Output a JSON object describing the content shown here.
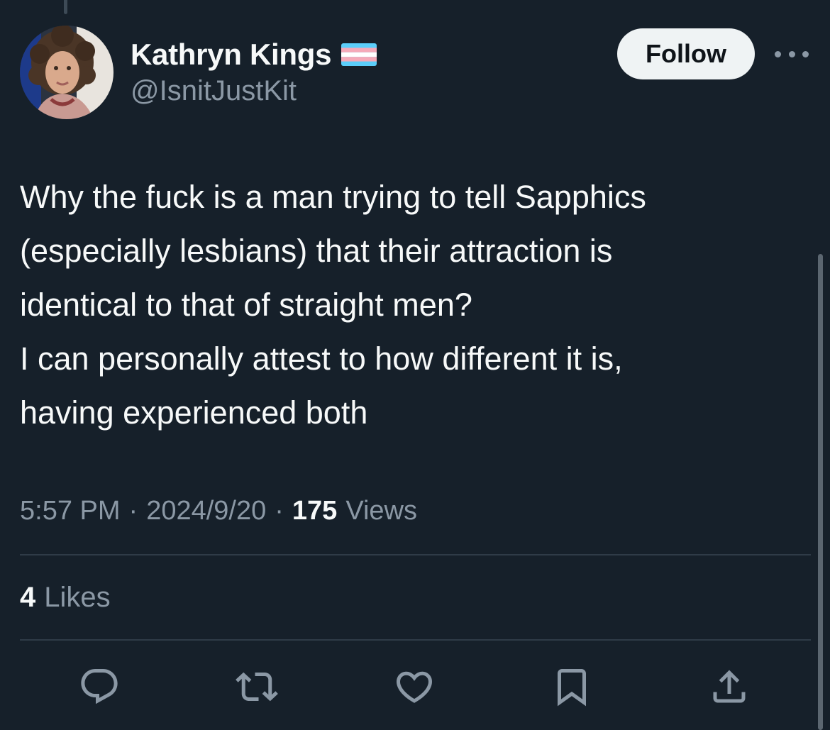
{
  "author": {
    "display_name": "Kathryn Kings",
    "handle": "@IsnitJustKit",
    "name_badge_icon": "transgender-flag-icon"
  },
  "header": {
    "follow_label": "Follow",
    "more_icon": "more-horizontal-icon"
  },
  "tweet": {
    "lines": [
      "Why the fuck is a man trying to tell Sapphics",
      "(especially lesbians) that their attraction is",
      "identical to that of straight men?",
      "I can personally attest to how different it is,",
      "having experienced both"
    ]
  },
  "meta": {
    "time": "5:57 PM",
    "separator": "·",
    "date": "2024/9/20",
    "views_count": "175",
    "views_label": "Views"
  },
  "engagement": {
    "likes_count": "4",
    "likes_label": "Likes"
  },
  "actions": [
    {
      "name": "reply",
      "icon": "reply-icon"
    },
    {
      "name": "retweet",
      "icon": "retweet-icon"
    },
    {
      "name": "like",
      "icon": "heart-icon"
    },
    {
      "name": "bookmark",
      "icon": "bookmark-icon"
    },
    {
      "name": "share",
      "icon": "share-icon"
    }
  ],
  "colors": {
    "background": "#16202a",
    "primary_text": "#f7f9f9",
    "secondary_text": "#8b98a5",
    "divider": "#2f3b47",
    "follow_button_bg": "#eff3f4",
    "trans_flag_blue": "#5bcefa",
    "trans_flag_pink": "#f5a9b8",
    "trans_flag_white": "#ffffff"
  }
}
